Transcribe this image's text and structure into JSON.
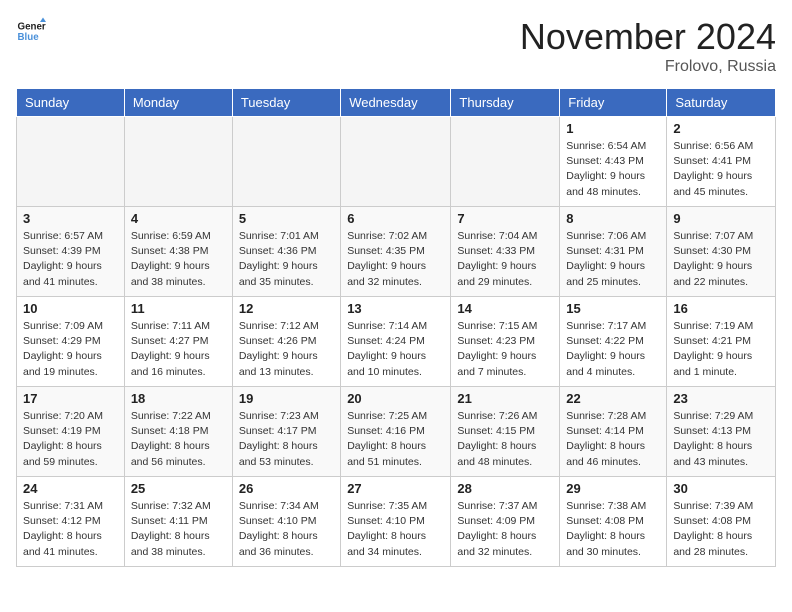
{
  "logo": {
    "line1": "General",
    "line2": "Blue"
  },
  "title": "November 2024",
  "location": "Frolovo, Russia",
  "days_of_week": [
    "Sunday",
    "Monday",
    "Tuesday",
    "Wednesday",
    "Thursday",
    "Friday",
    "Saturday"
  ],
  "weeks": [
    [
      {
        "day": "",
        "detail": ""
      },
      {
        "day": "",
        "detail": ""
      },
      {
        "day": "",
        "detail": ""
      },
      {
        "day": "",
        "detail": ""
      },
      {
        "day": "",
        "detail": ""
      },
      {
        "day": "1",
        "detail": "Sunrise: 6:54 AM\nSunset: 4:43 PM\nDaylight: 9 hours\nand 48 minutes."
      },
      {
        "day": "2",
        "detail": "Sunrise: 6:56 AM\nSunset: 4:41 PM\nDaylight: 9 hours\nand 45 minutes."
      }
    ],
    [
      {
        "day": "3",
        "detail": "Sunrise: 6:57 AM\nSunset: 4:39 PM\nDaylight: 9 hours\nand 41 minutes."
      },
      {
        "day": "4",
        "detail": "Sunrise: 6:59 AM\nSunset: 4:38 PM\nDaylight: 9 hours\nand 38 minutes."
      },
      {
        "day": "5",
        "detail": "Sunrise: 7:01 AM\nSunset: 4:36 PM\nDaylight: 9 hours\nand 35 minutes."
      },
      {
        "day": "6",
        "detail": "Sunrise: 7:02 AM\nSunset: 4:35 PM\nDaylight: 9 hours\nand 32 minutes."
      },
      {
        "day": "7",
        "detail": "Sunrise: 7:04 AM\nSunset: 4:33 PM\nDaylight: 9 hours\nand 29 minutes."
      },
      {
        "day": "8",
        "detail": "Sunrise: 7:06 AM\nSunset: 4:31 PM\nDaylight: 9 hours\nand 25 minutes."
      },
      {
        "day": "9",
        "detail": "Sunrise: 7:07 AM\nSunset: 4:30 PM\nDaylight: 9 hours\nand 22 minutes."
      }
    ],
    [
      {
        "day": "10",
        "detail": "Sunrise: 7:09 AM\nSunset: 4:29 PM\nDaylight: 9 hours\nand 19 minutes."
      },
      {
        "day": "11",
        "detail": "Sunrise: 7:11 AM\nSunset: 4:27 PM\nDaylight: 9 hours\nand 16 minutes."
      },
      {
        "day": "12",
        "detail": "Sunrise: 7:12 AM\nSunset: 4:26 PM\nDaylight: 9 hours\nand 13 minutes."
      },
      {
        "day": "13",
        "detail": "Sunrise: 7:14 AM\nSunset: 4:24 PM\nDaylight: 9 hours\nand 10 minutes."
      },
      {
        "day": "14",
        "detail": "Sunrise: 7:15 AM\nSunset: 4:23 PM\nDaylight: 9 hours\nand 7 minutes."
      },
      {
        "day": "15",
        "detail": "Sunrise: 7:17 AM\nSunset: 4:22 PM\nDaylight: 9 hours\nand 4 minutes."
      },
      {
        "day": "16",
        "detail": "Sunrise: 7:19 AM\nSunset: 4:21 PM\nDaylight: 9 hours\nand 1 minute."
      }
    ],
    [
      {
        "day": "17",
        "detail": "Sunrise: 7:20 AM\nSunset: 4:19 PM\nDaylight: 8 hours\nand 59 minutes."
      },
      {
        "day": "18",
        "detail": "Sunrise: 7:22 AM\nSunset: 4:18 PM\nDaylight: 8 hours\nand 56 minutes."
      },
      {
        "day": "19",
        "detail": "Sunrise: 7:23 AM\nSunset: 4:17 PM\nDaylight: 8 hours\nand 53 minutes."
      },
      {
        "day": "20",
        "detail": "Sunrise: 7:25 AM\nSunset: 4:16 PM\nDaylight: 8 hours\nand 51 minutes."
      },
      {
        "day": "21",
        "detail": "Sunrise: 7:26 AM\nSunset: 4:15 PM\nDaylight: 8 hours\nand 48 minutes."
      },
      {
        "day": "22",
        "detail": "Sunrise: 7:28 AM\nSunset: 4:14 PM\nDaylight: 8 hours\nand 46 minutes."
      },
      {
        "day": "23",
        "detail": "Sunrise: 7:29 AM\nSunset: 4:13 PM\nDaylight: 8 hours\nand 43 minutes."
      }
    ],
    [
      {
        "day": "24",
        "detail": "Sunrise: 7:31 AM\nSunset: 4:12 PM\nDaylight: 8 hours\nand 41 minutes."
      },
      {
        "day": "25",
        "detail": "Sunrise: 7:32 AM\nSunset: 4:11 PM\nDaylight: 8 hours\nand 38 minutes."
      },
      {
        "day": "26",
        "detail": "Sunrise: 7:34 AM\nSunset: 4:10 PM\nDaylight: 8 hours\nand 36 minutes."
      },
      {
        "day": "27",
        "detail": "Sunrise: 7:35 AM\nSunset: 4:10 PM\nDaylight: 8 hours\nand 34 minutes."
      },
      {
        "day": "28",
        "detail": "Sunrise: 7:37 AM\nSunset: 4:09 PM\nDaylight: 8 hours\nand 32 minutes."
      },
      {
        "day": "29",
        "detail": "Sunrise: 7:38 AM\nSunset: 4:08 PM\nDaylight: 8 hours\nand 30 minutes."
      },
      {
        "day": "30",
        "detail": "Sunrise: 7:39 AM\nSunset: 4:08 PM\nDaylight: 8 hours\nand 28 minutes."
      }
    ]
  ]
}
